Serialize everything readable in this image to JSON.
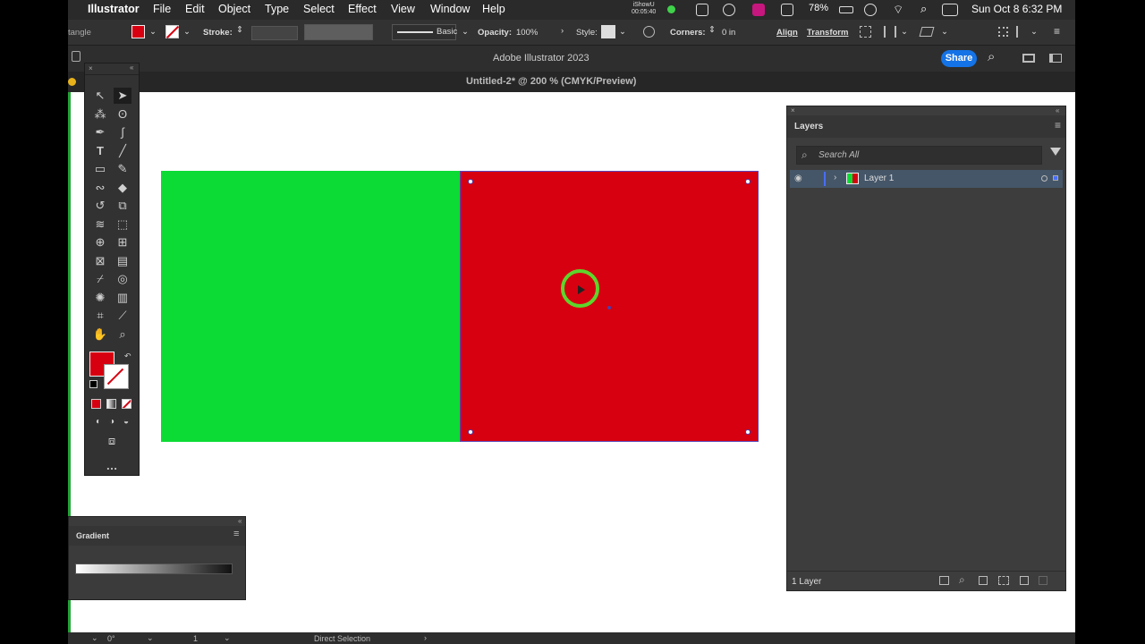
{
  "menubar": {
    "app": "Illustrator",
    "items": [
      "File",
      "Edit",
      "Object",
      "Type",
      "Select",
      "Effect",
      "View",
      "Window",
      "Help"
    ],
    "recorder_name": "iShowU",
    "recorder_time": "00:05:40",
    "battery": "78%",
    "clock": "Sun Oct 8  6:32 PM"
  },
  "controlbar": {
    "object_type": "tangle",
    "stroke_label": "Stroke:",
    "stroke_style": "Basic",
    "opacity_label": "Opacity:",
    "opacity_value": "100%",
    "style_label": "Style:",
    "corners_label": "Corners:",
    "corners_value": "0 in",
    "align_label": "Align",
    "transform_label": "Transform",
    "fill_color": "#d70010"
  },
  "appbar": {
    "title": "Adobe Illustrator 2023",
    "share": "Share"
  },
  "document": {
    "title": "Untitled-2* @ 200 % (CMYK/Preview)"
  },
  "artwork": {
    "left_color": "#0cdb36",
    "right_color": "#d70010"
  },
  "layers_panel": {
    "tab": "Layers",
    "search_placeholder": "Search All",
    "layers": [
      {
        "name": "Layer 1"
      }
    ],
    "count_label": "1 Layer"
  },
  "gradient_panel": {
    "tab": "Gradient"
  },
  "statusbar": {
    "angle": "0°",
    "artboard": "1",
    "tool": "Direct Selection"
  }
}
